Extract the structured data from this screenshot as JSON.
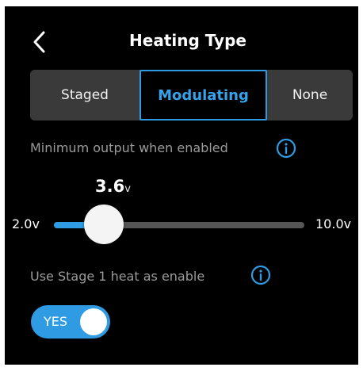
{
  "header": {
    "title": "Heating Type",
    "back_icon": "chevron-left-icon"
  },
  "heating_type": {
    "options": [
      "Staged",
      "Modulating",
      "None"
    ],
    "selected": "Modulating"
  },
  "min_output": {
    "label": "Minimum output when enabled",
    "info_icon": "info-icon",
    "value": "3.6",
    "unit": "v",
    "value_number": 3.6,
    "min_label": "2.0v",
    "max_label": "10.0v",
    "min": 2.0,
    "max": 10.0
  },
  "stage1_enable": {
    "label": "Use Stage 1 heat as enable",
    "info_icon": "info-icon",
    "toggle_label": "YES",
    "enabled": true
  },
  "colors": {
    "accent": "#2f9be3",
    "background": "#000000",
    "segmented_bg": "#3a3a3a",
    "muted_text": "#9b9b9b",
    "track": "#555555"
  }
}
